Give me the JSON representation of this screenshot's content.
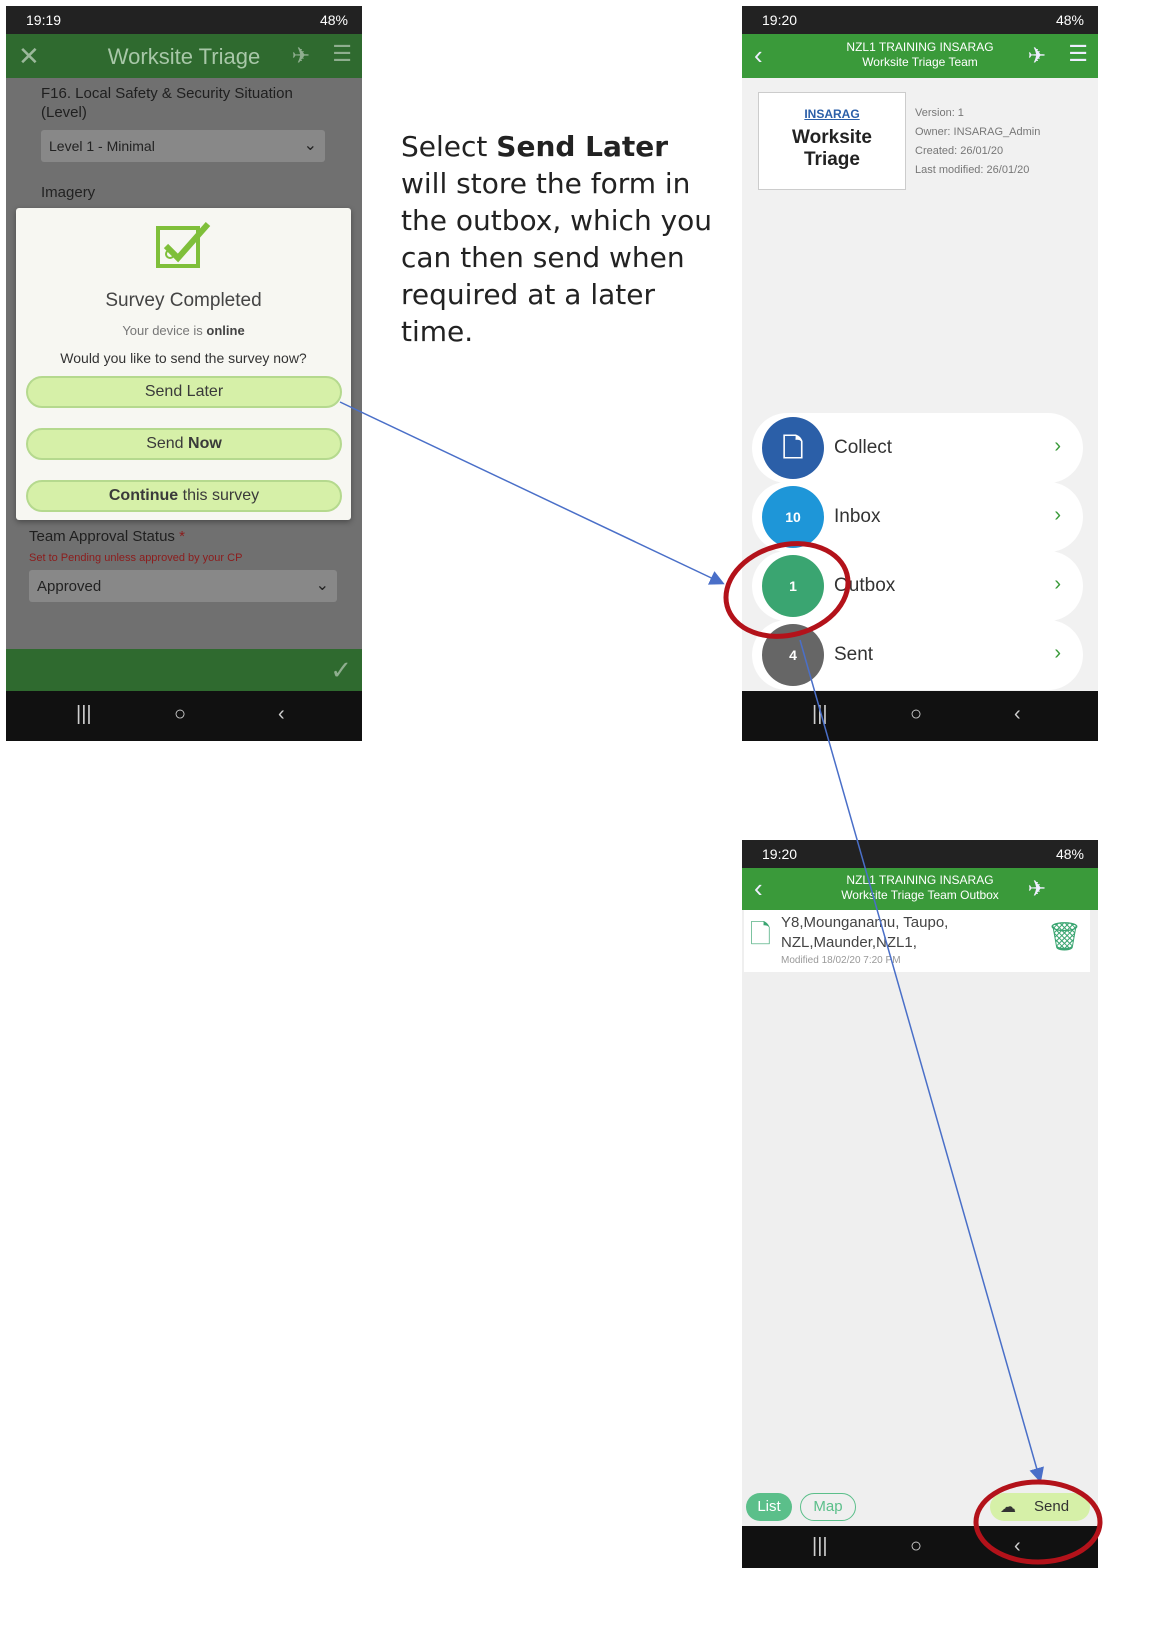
{
  "phone1": {
    "status_time": "19:19",
    "status_right": "48%",
    "appbar_title": "Worksite Triage",
    "field_label": "F16. Local Safety & Security Situation (Level)",
    "field_value": "Level 1 - Minimal",
    "section_label": "Imagery",
    "dialog": {
      "title": "Survey Completed",
      "online_prefix": "Your device is",
      "online_word": "online",
      "question": "Would you like to send the survey now?",
      "send_later": "Send Later",
      "send_now_prefix": "Send",
      "send_now_bold": "Now",
      "continue_bold": "Continue",
      "continue_suffix": "this survey"
    },
    "approval_label": "Team Approval Status",
    "approval_required": "*",
    "approval_hint": "Set to Pending unless approved by your CP",
    "approval_value": "Approved"
  },
  "instruction": {
    "prefix": "Select",
    "bold": "Send Later",
    "suffix": "will store the form in the outbox, which you can then send when required at a later time."
  },
  "phone2": {
    "status_time": "19:20",
    "status_right": "48%",
    "appbar_line1": "NZL1 TRAINING INSARAG",
    "appbar_line2": "Worksite Triage Team",
    "thumb_logo": "INSARAG",
    "thumb_title_1": "Worksite",
    "thumb_title_2": "Triage",
    "info": {
      "version": "Version: 1",
      "owner": "Owner: INSARAG_Admin",
      "created": "Created: 26/01/20",
      "modified": "Last modified: 26/01/20"
    },
    "menu": [
      {
        "label": "Collect",
        "badge": "",
        "color": "#2b5fa8"
      },
      {
        "label": "Inbox",
        "badge": "10",
        "color": "#1e96d8"
      },
      {
        "label": "Outbox",
        "badge": "1",
        "color": "#3aa571"
      },
      {
        "label": "Sent",
        "badge": "4",
        "color": "#666666"
      }
    ]
  },
  "phone3": {
    "status_time": "19:20",
    "status_right": "48%",
    "appbar_line1": "NZL1 TRAINING INSARAG",
    "appbar_line2": "Worksite Triage Team Outbox",
    "item_line1": "Y8,Mounganamu, Taupo,",
    "item_line2": "NZL,Maunder,NZL1,",
    "item_modified": "Modified 18/02/20 7:20 PM",
    "tab_list": "List",
    "tab_map": "Map",
    "send_label": "Send"
  },
  "colors": {
    "appbar_green": "#3a9a3a",
    "pill_green": "#d6f0a8",
    "highlight_red": "#b3121a",
    "arrow_blue": "#4a6fc8"
  }
}
